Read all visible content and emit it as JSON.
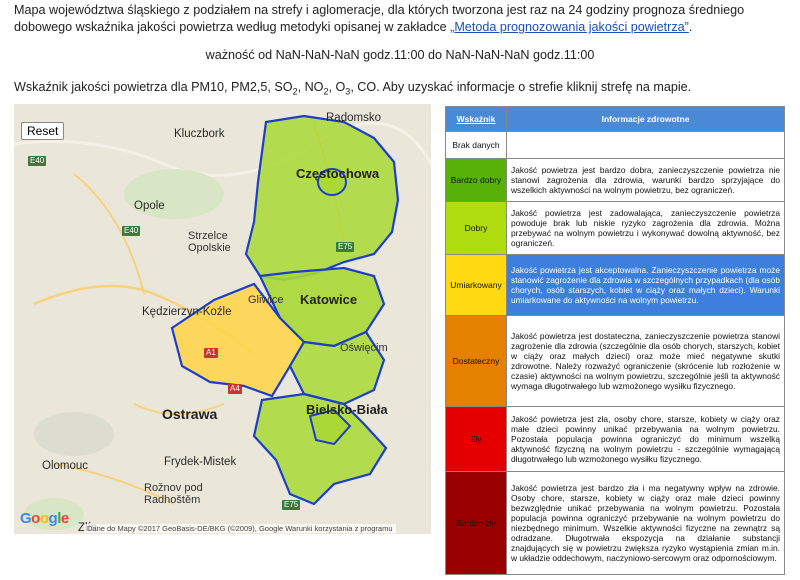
{
  "intro": {
    "text": "Mapa województwa śląskiego z podziałem na strefy i aglomeracje, dla których tworzona jest raz na 24 godziny prognoza średniego dobowego wskaźnika jakości powietrza według metodyki opisanej w zakładce ",
    "link": "„Metoda prognozowania jakości powietrza”",
    "end": "."
  },
  "validity": "ważność od NaN-NaN-NaN godz.11:00 do NaN-NaN-NaN godz.11:00",
  "pollutants": {
    "pre": "Wskaźnik jakości powietrza dla PM10, PM2,5, SO",
    "sub1": "2",
    "mid1": ", NO",
    "sub2": "2",
    "mid2": ", O",
    "sub3": "3",
    "post": ", CO. Aby uzyskać informacje o strefie kliknij strefę na mapie."
  },
  "map": {
    "reset_label": "Reset",
    "labels": {
      "radomsko": "Radomsko",
      "kluczbork": "Kluczbork",
      "czestochowa": "Częstochowa",
      "opole": "Opole",
      "strzelce": "Strzelce\nOpolskie",
      "kedzierzyn": "Kędzierzyn-Koźle",
      "katowice": "Katowice",
      "gliwice": "Gliwice",
      "oswiecim": "Oświęcim",
      "ostrawa": "Ostrawa",
      "bielsko": "Bielsko-Biała",
      "olomouc": "Olomouc",
      "frydek": "Frydek-Mistek",
      "roznov": "Rožnov pod\nRadhoštěm",
      "zlin": "Zlín"
    },
    "roads": [
      "E40",
      "E75",
      "E40",
      "A4",
      "A1",
      "E75"
    ],
    "google_logo": "Google",
    "attribution": "Dane do Mapy ©2017 GeoBasis-DE/BKG (©2009), Google    Warunki korzystania z programu"
  },
  "legend": {
    "header_index": "Wskaźnik",
    "header_info": "Informacje zdrowotne",
    "rows": [
      {
        "category": "Brak danych",
        "color": "#ffffff",
        "text": ""
      },
      {
        "category": "Bardzo dobry",
        "color": "#57b108",
        "text": "Jakość powietrza jest bardzo dobra, zanieczyszczenie powietrza nie stanowi zagrożenia dla zdrowia, warunki bardzo sprzyjające do wszelkich aktywności na wolnym powietrzu, bez ograniczeń."
      },
      {
        "category": "Dobry",
        "color": "#b0dd10",
        "text": "Jakość powietrza jest zadowalająca, zanieczyszczenie powietrza powoduje brak lub niskie ryzyko zagrożenia dla zdrowia. Można przebywać na wolnym powietrzu i wykonywać dowolną aktywność, bez ograniczeń."
      },
      {
        "category": "Umiarkowany",
        "color": "#ffd911",
        "text": "Jakość powietrza jest akceptowalna. Zanieczyszczenie powietrza może stanowić zagrożenie dla zdrowia w szczególnych przypadkach (dla osób chorych, osób starszych, kobiet w ciąży oraz małych dzieci). Warunki umiarkowane do aktywności na wolnym powietrzu."
      },
      {
        "category": "Dostateczny",
        "color": "#e58100",
        "text": "Jakość powietrza jest dostateczna, zanieczyszczenie powietrza stanowi zagrożenie dla zdrowia (szczególnie dla osób chorych, starszych, kobiet w ciąży oraz małych dzieci) oraz może mieć negatywne skutki zdrowotne. Należy rozważyć ograniczenie (skrócenie lub rozłożenie w czasie) aktywności na wolnym powietrzu, szczególnie jeśli ta aktywność wymaga długotrwałego lub wzmożonego wysiłku fizycznego."
      },
      {
        "category": "Zły",
        "color": "#e50000",
        "text": "Jakość powietrza jest zła, osoby chore, starsze, kobiety w ciąży oraz małe dzieci powinny unikać przebywania na wolnym powietrzu. Pozostała populacja powinna ograniczyć do minimum wszelką aktywność fizyczną na wolnym powietrzu - szczególnie wymagającą długotrwałego lub wzmożonego wysiłku fizycznego."
      },
      {
        "category": "Bardzo zły",
        "color": "#990000",
        "text": "Jakość powietrza jest bardzo zła i ma negatywny wpływ na zdrowie. Osoby chore, starsze, kobiety w ciąży oraz małe dzieci powinny bezwzględnie unikać przebywania na wolnym powietrzu. Pozostała populacja powinna ograniczyć przebywanie na wolnym powietrzu do niezbędnego minimum. Wszelkie aktywności fizyczne na zewnątrz są odradzane. Długotrwała ekspozycja na działanie substancji znajdujących się w powietrzu zwiększa ryzyko wystąpienia zmian m.in. w układzie oddechowym, naczyniowo-sercowym oraz odpornościowym."
      }
    ]
  }
}
